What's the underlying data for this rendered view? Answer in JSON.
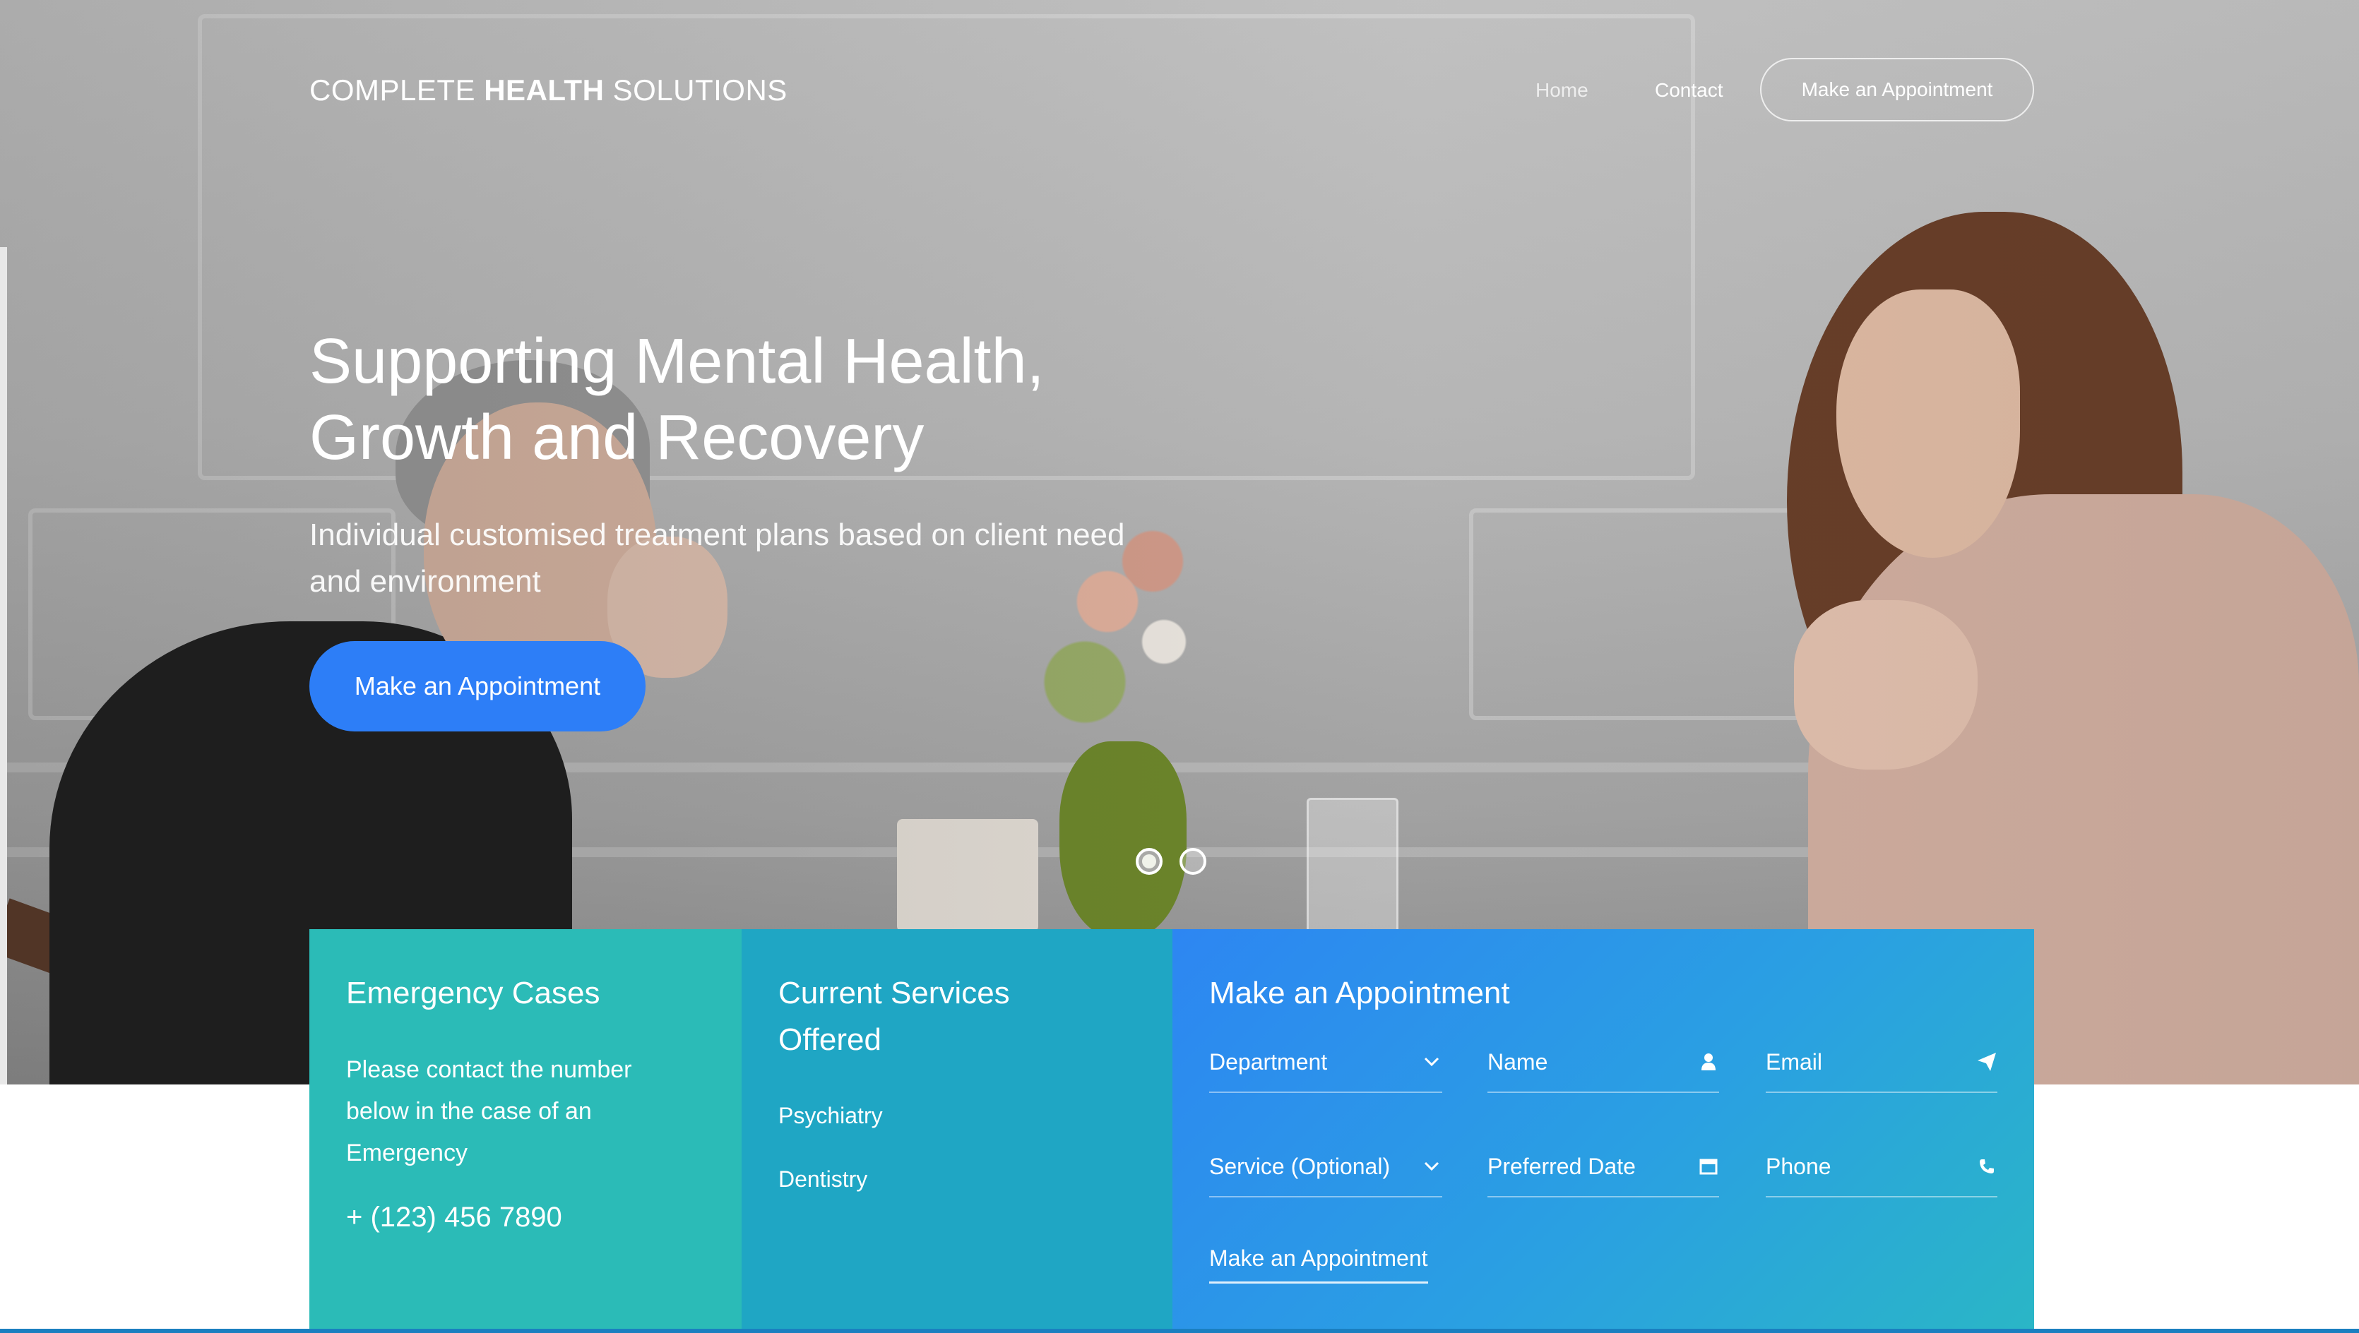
{
  "header": {
    "logo_light": "COMPLETE",
    "logo_bold": "HEALTH",
    "logo_end": "SOLUTIONS",
    "nav": {
      "home": "Home",
      "contact": "Contact",
      "cta": "Make an Appointment"
    }
  },
  "hero": {
    "title_line1": "Supporting Mental Health,",
    "title_line2": "Growth and Recovery",
    "subtitle_line1": "Individual customised treatment plans based on client need",
    "subtitle_line2": "and environment",
    "button": "Make an Appointment",
    "slider": {
      "count": 2,
      "active_index": 0
    }
  },
  "emergency": {
    "title": "Emergency Cases",
    "text": "Please contact the number below in the case of an Emergency",
    "phone": "+ (123) 456 7890"
  },
  "services": {
    "title": "Current Services Offered",
    "items": [
      "Psychiatry",
      "Dentistry"
    ]
  },
  "appointment": {
    "title": "Make an Appointment",
    "fields": {
      "department": "Department",
      "name": "Name",
      "email": "Email",
      "service": "Service (Optional)",
      "preferred_date": "Preferred Date",
      "phone": "Phone"
    },
    "submit": "Make an Appointment"
  },
  "icons": {
    "department": "chevron-down-icon",
    "name": "user-icon",
    "email": "paper-plane-icon",
    "service": "chevron-down-icon",
    "date": "calendar-icon",
    "phone": "phone-icon"
  },
  "colors": {
    "primary_button": "#2d7ef7",
    "emergency_card": "#2bbbb7",
    "services_card": "#1fa6c4",
    "appointment_gradient_start": "#2d86f2",
    "appointment_gradient_end": "#2ab6c6"
  }
}
